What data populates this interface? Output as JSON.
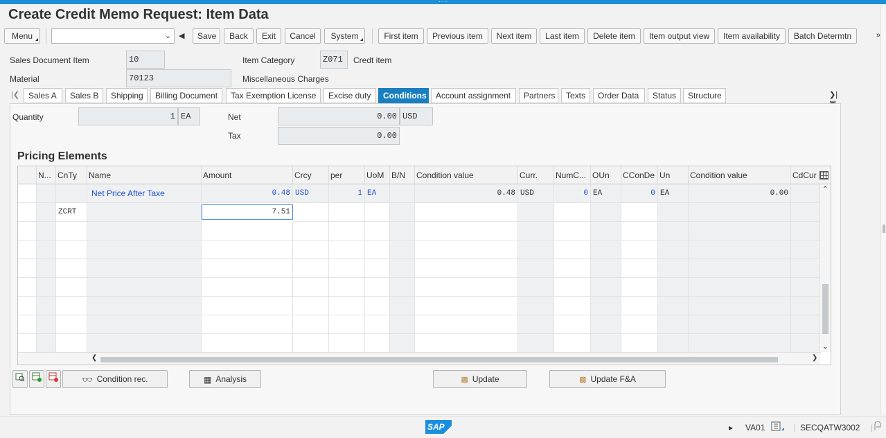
{
  "window": {
    "title": "Create Credit Memo Request: Item Data"
  },
  "toolbar": {
    "menu": "Menu",
    "command_value": "",
    "buttons": [
      "Save",
      "Back",
      "Exit",
      "Cancel",
      "System",
      "First item",
      "Previous item",
      "Next item",
      "Last item",
      "Delete item",
      "Item output view",
      "Item availability",
      "Batch Determtn"
    ]
  },
  "header": {
    "sales_doc_item_label": "Sales Document Item",
    "sales_doc_item_value": "10",
    "item_category_label": "Item Category",
    "item_category_value": "Z071",
    "item_category_text": "Credt item",
    "material_label": "Material",
    "material_value": "70123",
    "material_text": "Miscellaneous Charges"
  },
  "tabs": [
    "Sales A",
    "Sales B",
    "Shipping",
    "Billing Document",
    "Tax Exemption License",
    "Excise duty",
    "Conditions",
    "Account assignment",
    "Partners",
    "Texts",
    "Order Data",
    "Status",
    "Structure"
  ],
  "active_tab": "Conditions",
  "conditions": {
    "quantity_label": "Quantity",
    "quantity_value": "1",
    "quantity_unit": "EA",
    "net_label": "Net",
    "net_value": "0.00",
    "net_currency": "USD",
    "tax_label": "Tax",
    "tax_value": "0.00"
  },
  "pricing": {
    "title": "Pricing Elements",
    "columns": [
      "N...",
      "CnTy",
      "Name",
      "Amount",
      "Crcy",
      "per",
      "UoM",
      "B/N",
      "Condition value",
      "Curr.",
      "NumC...",
      "OUn",
      "CConDe",
      "Un",
      "Condition value",
      "CdCur"
    ],
    "rows": [
      {
        "cnty": "",
        "name": "Net Price After Taxe",
        "amount": "0.48",
        "crcy": "USD",
        "per": "1",
        "uom": "EA",
        "bn": "",
        "cond_value": "0.48",
        "curr": "USD",
        "numc": "0",
        "oun": "EA",
        "ccon": "0",
        "un": "EA",
        "cond_value2": "0.00"
      },
      {
        "cnty": "ZCRT",
        "name": "",
        "amount": "7.51",
        "crcy": "",
        "per": "",
        "uom": "",
        "bn": "",
        "cond_value": "",
        "curr": "",
        "numc": "",
        "oun": "",
        "ccon": "",
        "un": "",
        "cond_value2": ""
      }
    ]
  },
  "bottom_buttons": {
    "condition_rec": "Condition rec.",
    "analysis": "Analysis",
    "update": "Update",
    "update_fa": "Update F&A"
  },
  "statusbar": {
    "logo": "SAP",
    "transaction": "VA01",
    "system": "SECQATW3002"
  },
  "colors": {
    "accent": "#1a7fc0",
    "link_blue": "#2150cc",
    "topbar": "#1c8fd6"
  }
}
